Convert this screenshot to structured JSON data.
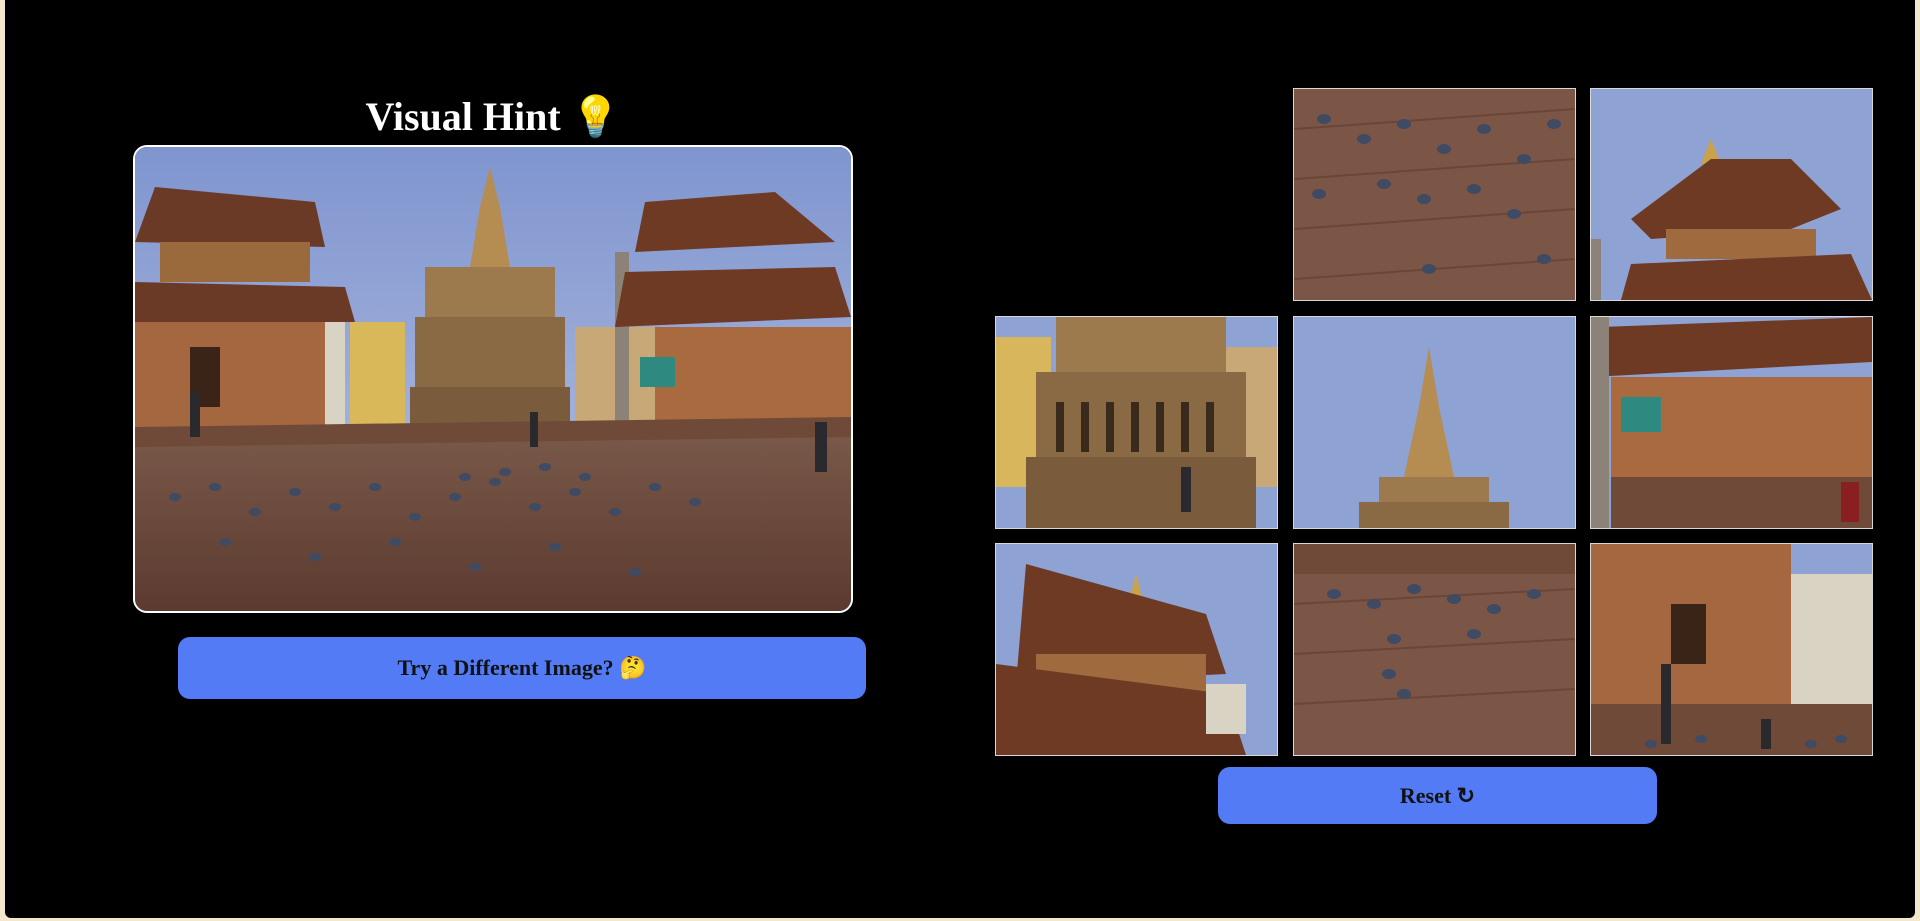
{
  "hint": {
    "title": "Visual Hint",
    "title_icon": "lightbulb-icon",
    "title_emoji": "💡"
  },
  "buttons": {
    "try_different_label": "Try a Different Image? 🤔",
    "reset_label": "Reset ↻"
  },
  "puzzle": {
    "grid_size": 3,
    "empty_slot": 0,
    "tiles": [
      {
        "slot": 1,
        "piece": "pigeons-upper-square"
      },
      {
        "slot": 2,
        "piece": "right-pagoda-roof"
      },
      {
        "slot": 3,
        "piece": "central-temple-base"
      },
      {
        "slot": 4,
        "piece": "central-spire"
      },
      {
        "slot": 5,
        "piece": "right-pagoda-base"
      },
      {
        "slot": 6,
        "piece": "left-pagoda-roof"
      },
      {
        "slot": 7,
        "piece": "pigeons-lower-square"
      },
      {
        "slot": 8,
        "piece": "left-temple-steps"
      }
    ]
  },
  "colors": {
    "background": "#000000",
    "button": "#537bf6",
    "sky": "#8fa3d6",
    "brick": "#7a4a3a",
    "stone": "#8a6a48"
  }
}
